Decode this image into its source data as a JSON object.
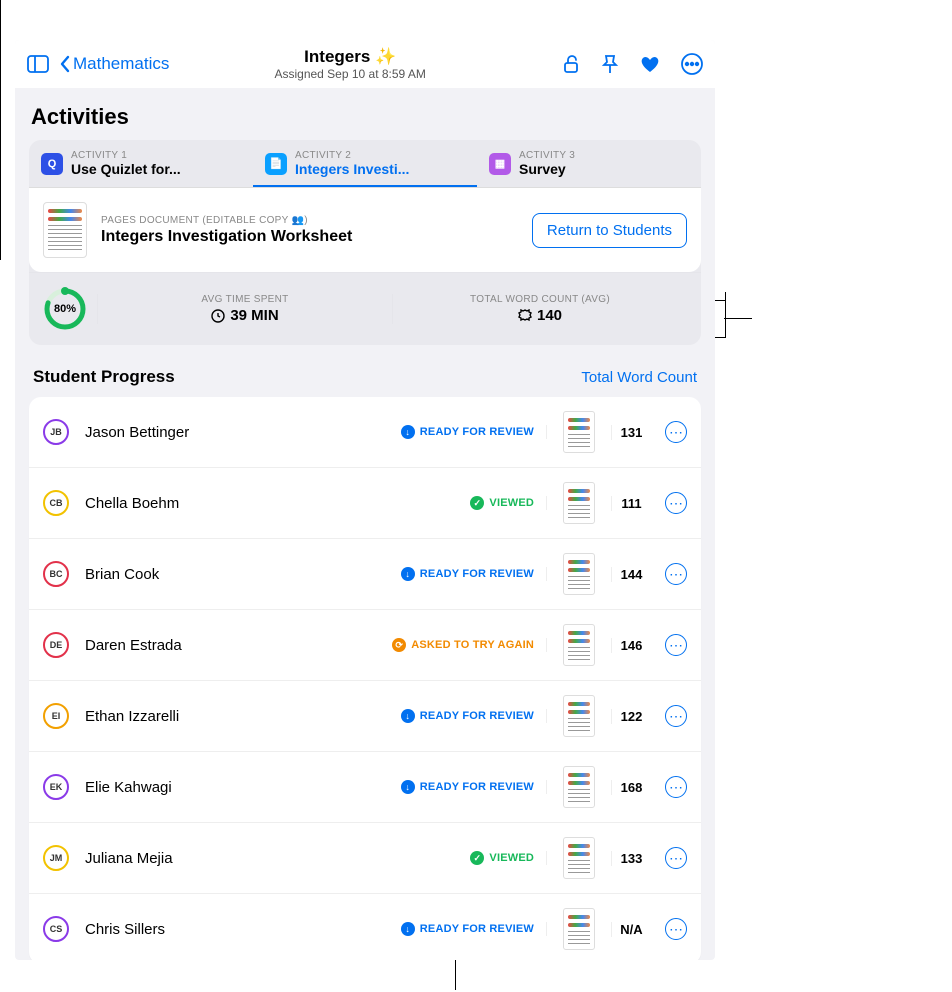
{
  "nav": {
    "back_label": "Mathematics",
    "title": "Integers ✨",
    "subtitle": "Assigned Sep 10 at 8:59 AM"
  },
  "section_title": "Activities",
  "tabs": [
    {
      "eyebrow": "ACTIVITY 1",
      "label": "Use Quizlet for...",
      "icon_bg": "#2d50e6",
      "icon_glyph": "Q",
      "active": false
    },
    {
      "eyebrow": "ACTIVITY 2",
      "label": "Integers Investi...",
      "icon_bg": "#0aa0ff",
      "icon_glyph": "📄",
      "active": true
    },
    {
      "eyebrow": "ACTIVITY 3",
      "label": "Survey",
      "icon_bg": "#b25ae8",
      "icon_glyph": "▦",
      "active": false
    }
  ],
  "document": {
    "eyebrow": "PAGES DOCUMENT (EDITABLE COPY 👥)",
    "title": "Integers Investigation Worksheet",
    "return_btn": "Return to Students"
  },
  "stats": {
    "progress_pct": "80%",
    "time_eyebrow": "AVG TIME SPENT",
    "time_value": "39 MIN",
    "words_eyebrow": "TOTAL WORD COUNT (AVG)",
    "words_value": "140"
  },
  "list_header": {
    "title": "Student Progress",
    "link": "Total Word Count"
  },
  "status_labels": {
    "ready": "READY FOR REVIEW",
    "viewed": "VIEWED",
    "try_again": "ASKED TO TRY AGAIN"
  },
  "students": [
    {
      "initials": "JB",
      "ring": "#8a3ae8",
      "name": "Jason Bettinger",
      "status": "ready",
      "count": "131"
    },
    {
      "initials": "CB",
      "ring": "#f2c200",
      "name": "Chella Boehm",
      "status": "viewed",
      "count": "111"
    },
    {
      "initials": "BC",
      "ring": "#e2314a",
      "name": "Brian Cook",
      "status": "ready",
      "count": "144"
    },
    {
      "initials": "DE",
      "ring": "#e2314a",
      "name": "Daren Estrada",
      "status": "try_again",
      "count": "146"
    },
    {
      "initials": "EI",
      "ring": "#f2a000",
      "name": "Ethan Izzarelli",
      "status": "ready",
      "count": "122"
    },
    {
      "initials": "EK",
      "ring": "#8a3ae8",
      "name": "Elie Kahwagi",
      "status": "ready",
      "count": "168"
    },
    {
      "initials": "JM",
      "ring": "#f2c200",
      "name": "Juliana Mejia",
      "status": "viewed",
      "count": "133"
    },
    {
      "initials": "CS",
      "ring": "#8a3ae8",
      "name": "Chris Sillers",
      "status": "ready",
      "count": "N/A"
    }
  ],
  "status_styles": {
    "ready": {
      "color": "#0170f0",
      "glyph": "↓"
    },
    "viewed": {
      "color": "#18b85a",
      "glyph": "✓"
    },
    "try_again": {
      "color": "#f28a00",
      "glyph": "⟳"
    }
  }
}
